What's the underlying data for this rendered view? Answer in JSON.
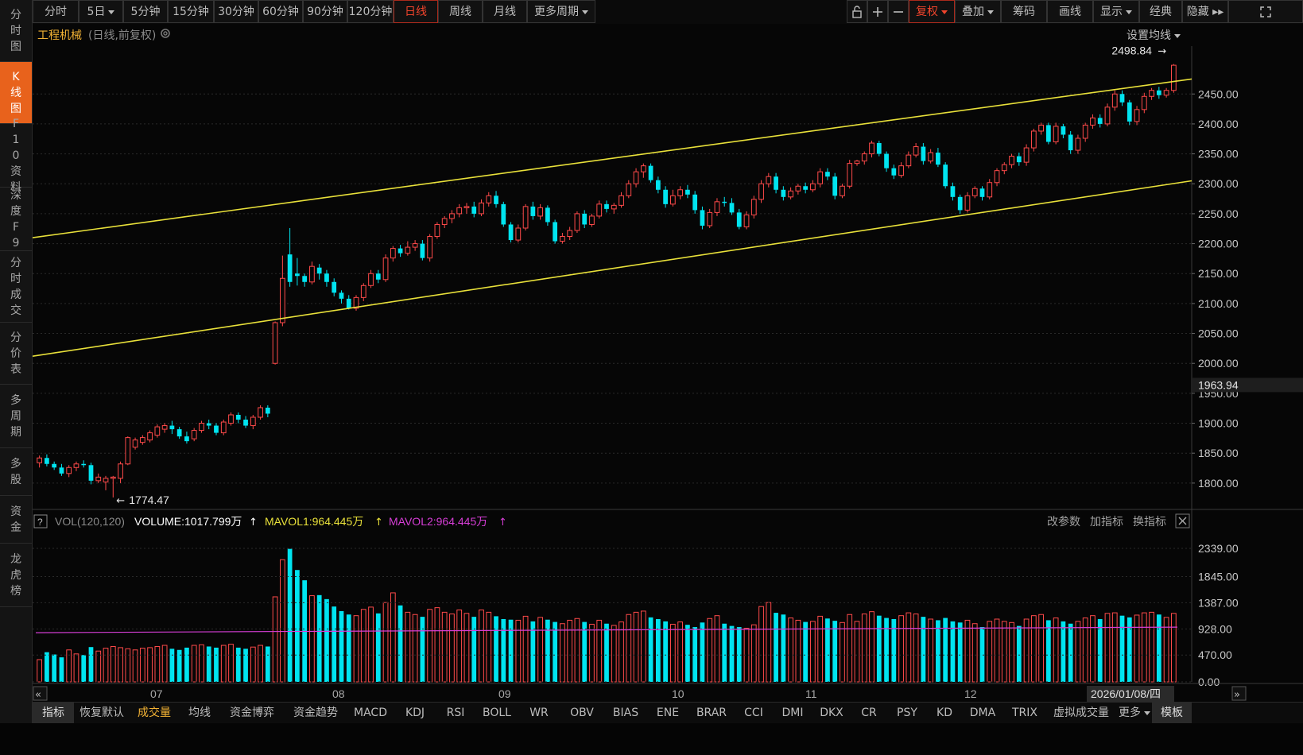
{
  "left_nav": [
    {
      "label": "分时图",
      "active": false
    },
    {
      "label": "K线图",
      "active": true
    },
    {
      "label": "F10资料",
      "active": false
    },
    {
      "label": "深度F9",
      "active": false
    },
    {
      "label": "分时成交",
      "active": false
    },
    {
      "label": "分价表",
      "active": false
    },
    {
      "label": "多周期",
      "active": false
    },
    {
      "label": "多股",
      "active": false
    },
    {
      "label": "资金",
      "active": false
    },
    {
      "label": "龙虎榜",
      "active": false
    }
  ],
  "period_tabs": [
    {
      "label": "分时"
    },
    {
      "label": "5日",
      "caret": true
    },
    {
      "label": "5分钟"
    },
    {
      "label": "15分钟"
    },
    {
      "label": "30分钟"
    },
    {
      "label": "60分钟"
    },
    {
      "label": "90分钟"
    },
    {
      "label": "120分钟"
    },
    {
      "label": "日线",
      "active": true
    },
    {
      "label": "周线"
    },
    {
      "label": "月线"
    },
    {
      "label": "更多周期",
      "caret": true
    }
  ],
  "right_tools": [
    {
      "label": "复权",
      "caret": true,
      "active": true
    },
    {
      "label": "叠加",
      "caret": true
    },
    {
      "label": "筹码"
    },
    {
      "label": "画线"
    },
    {
      "label": "显示",
      "caret": true
    },
    {
      "label": "经典"
    },
    {
      "label": "隐藏 ▸▸"
    }
  ],
  "chart_header": {
    "name": "工程机械",
    "mode": "(日线,前复权)",
    "ma_setting": "设置均线"
  },
  "indicator_header": {
    "help": "?",
    "name": "VOL(120,120)",
    "volume": "VOLUME:1017.799万",
    "mavol1": "MAVOL1:964.445万",
    "mavol2": "MAVOL2:964.445万",
    "change_params": "改参数",
    "add_indicator": "加指标",
    "switch_indicator": "换指标"
  },
  "colors": {
    "up": "#ff4a4a",
    "down": "#00e4f0",
    "channel": "#e8e03a",
    "mavol1": "#e8e03a",
    "mavol2": "#d63ed6",
    "accent": "#e8621c"
  },
  "chart_data": {
    "type": "candlestick",
    "price_axis": [
      "2450.00",
      "2400.00",
      "2350.00",
      "2300.00",
      "2250.00",
      "2200.00",
      "2150.00",
      "2100.00",
      "2050.00",
      "2000.00",
      "1950.00",
      "1900.00",
      "1850.00",
      "1800.00"
    ],
    "price_range": [
      1760,
      2530
    ],
    "current_price": "1963.94",
    "high_label": "2498.84",
    "low_label": "1774.47",
    "volume_axis": [
      "2339.00",
      "1845.00",
      "1387.00",
      "928.00",
      "470.00",
      "0.00"
    ],
    "volume_max": 2339,
    "month_labels": [
      "07",
      "08",
      "09",
      "10",
      "11",
      "12"
    ],
    "cursor_date": "2026/01/08/四",
    "channel_lines": [
      {
        "from": [
          0,
          2210
        ],
        "to": [
          1,
          2475
        ]
      },
      {
        "from": [
          0,
          2012
        ],
        "to": [
          1,
          2305
        ]
      }
    ],
    "mavol_level": 820,
    "candles": [
      [
        1834,
        1842,
        1826,
        1846,
        390
      ],
      [
        1842,
        1832,
        1828,
        1848,
        520
      ],
      [
        1832,
        1826,
        1822,
        1836,
        480
      ],
      [
        1826,
        1816,
        1812,
        1832,
        430
      ],
      [
        1816,
        1826,
        1810,
        1830,
        560
      ],
      [
        1826,
        1832,
        1820,
        1836,
        490
      ],
      [
        1832,
        1830,
        1826,
        1838,
        470
      ],
      [
        1830,
        1804,
        1798,
        1834,
        610
      ],
      [
        1804,
        1810,
        1800,
        1816,
        540
      ],
      [
        1802,
        1808,
        1788,
        1812,
        590
      ],
      [
        1808,
        1810,
        1776,
        1812,
        620
      ],
      [
        1808,
        1832,
        1800,
        1836,
        600
      ],
      [
        1832,
        1876,
        1830,
        1878,
        580
      ],
      [
        1860,
        1872,
        1856,
        1876,
        560
      ],
      [
        1868,
        1876,
        1864,
        1880,
        590
      ],
      [
        1872,
        1884,
        1868,
        1888,
        600
      ],
      [
        1880,
        1894,
        1876,
        1898,
        620
      ],
      [
        1890,
        1896,
        1884,
        1900,
        640
      ],
      [
        1896,
        1890,
        1882,
        1904,
        580
      ],
      [
        1890,
        1878,
        1874,
        1894,
        560
      ],
      [
        1878,
        1870,
        1866,
        1886,
        600
      ],
      [
        1874,
        1888,
        1870,
        1892,
        640
      ],
      [
        1888,
        1900,
        1884,
        1904,
        650
      ],
      [
        1900,
        1896,
        1890,
        1906,
        620
      ],
      [
        1896,
        1884,
        1880,
        1900,
        600
      ],
      [
        1884,
        1902,
        1880,
        1906,
        640
      ],
      [
        1900,
        1914,
        1896,
        1918,
        660
      ],
      [
        1914,
        1906,
        1900,
        1918,
        600
      ],
      [
        1906,
        1896,
        1892,
        1912,
        580
      ],
      [
        1896,
        1910,
        1890,
        1914,
        610
      ],
      [
        1910,
        1926,
        1906,
        1930,
        640
      ],
      [
        1926,
        1916,
        1910,
        1930,
        620
      ],
      [
        2000,
        2068,
        1998,
        2070,
        1490
      ],
      [
        2068,
        2142,
        2062,
        2180,
        2140
      ],
      [
        2182,
        2136,
        2128,
        2226,
        2330
      ],
      [
        2150,
        2146,
        2130,
        2176,
        1960
      ],
      [
        2146,
        2136,
        2128,
        2150,
        1780
      ],
      [
        2136,
        2162,
        2132,
        2170,
        1510
      ],
      [
        2160,
        2150,
        2140,
        2166,
        1520
      ],
      [
        2150,
        2136,
        2128,
        2156,
        1450
      ],
      [
        2136,
        2118,
        2112,
        2142,
        1320
      ],
      [
        2118,
        2108,
        2100,
        2122,
        1240
      ],
      [
        2108,
        2092,
        2090,
        2114,
        1180
      ],
      [
        2092,
        2110,
        2088,
        2114,
        1160
      ],
      [
        2110,
        2130,
        2104,
        2134,
        1270
      ],
      [
        2130,
        2150,
        2126,
        2156,
        1310
      ],
      [
        2150,
        2140,
        2134,
        2156,
        1200
      ],
      [
        2140,
        2176,
        2136,
        2182,
        1390
      ],
      [
        2176,
        2192,
        2170,
        2196,
        1560
      ],
      [
        2192,
        2184,
        2178,
        2198,
        1340
      ],
      [
        2184,
        2194,
        2180,
        2204,
        1220
      ],
      [
        2194,
        2200,
        2188,
        2206,
        1180
      ],
      [
        2200,
        2176,
        2172,
        2206,
        1140
      ],
      [
        2176,
        2212,
        2170,
        2216,
        1270
      ],
      [
        2212,
        2232,
        2208,
        2236,
        1300
      ],
      [
        2232,
        2242,
        2226,
        2246,
        1220
      ],
      [
        2242,
        2250,
        2234,
        2256,
        1190
      ],
      [
        2250,
        2260,
        2244,
        2266,
        1260
      ],
      [
        2260,
        2262,
        2250,
        2268,
        1200
      ],
      [
        2262,
        2250,
        2244,
        2270,
        1140
      ],
      [
        2250,
        2268,
        2246,
        2274,
        1260
      ],
      [
        2268,
        2280,
        2262,
        2286,
        1220
      ],
      [
        2280,
        2266,
        2260,
        2288,
        1150
      ],
      [
        2266,
        2232,
        2228,
        2270,
        1100
      ],
      [
        2232,
        2206,
        2202,
        2236,
        1090
      ],
      [
        2206,
        2226,
        2202,
        2232,
        1080
      ],
      [
        2226,
        2262,
        2222,
        2266,
        1150
      ],
      [
        2262,
        2246,
        2240,
        2270,
        1060
      ],
      [
        2246,
        2260,
        2240,
        2266,
        1130
      ],
      [
        2260,
        2236,
        2230,
        2264,
        1090
      ],
      [
        2236,
        2204,
        2200,
        2240,
        1050
      ],
      [
        2204,
        2212,
        2200,
        2218,
        1020
      ],
      [
        2212,
        2222,
        2206,
        2228,
        1080
      ],
      [
        2222,
        2250,
        2218,
        2254,
        1110
      ],
      [
        2250,
        2232,
        2226,
        2256,
        1050
      ],
      [
        2232,
        2246,
        2228,
        2250,
        1010
      ],
      [
        2246,
        2266,
        2242,
        2272,
        1080
      ],
      [
        2266,
        2258,
        2252,
        2272,
        1020
      ],
      [
        2258,
        2264,
        2250,
        2268,
        990
      ],
      [
        2264,
        2280,
        2260,
        2286,
        1050
      ],
      [
        2280,
        2300,
        2276,
        2306,
        1180
      ],
      [
        2300,
        2320,
        2294,
        2326,
        1220
      ],
      [
        2320,
        2330,
        2310,
        2334,
        1240
      ],
      [
        2330,
        2306,
        2302,
        2334,
        1130
      ],
      [
        2306,
        2290,
        2284,
        2312,
        1100
      ],
      [
        2290,
        2266,
        2260,
        2296,
        1060
      ],
      [
        2266,
        2280,
        2262,
        2290,
        1010
      ],
      [
        2280,
        2290,
        2274,
        2296,
        1050
      ],
      [
        2290,
        2282,
        2276,
        2298,
        1000
      ],
      [
        2282,
        2256,
        2250,
        2288,
        960
      ],
      [
        2256,
        2230,
        2224,
        2262,
        1040
      ],
      [
        2230,
        2252,
        2226,
        2258,
        1110
      ],
      [
        2252,
        2270,
        2246,
        2276,
        1160
      ],
      [
        2270,
        2268,
        2262,
        2278,
        1020
      ],
      [
        2268,
        2252,
        2248,
        2276,
        980
      ],
      [
        2252,
        2228,
        2224,
        2258,
        960
      ],
      [
        2228,
        2248,
        2224,
        2254,
        940
      ],
      [
        2248,
        2274,
        2242,
        2280,
        1000
      ],
      [
        2274,
        2300,
        2268,
        2306,
        1320
      ],
      [
        2300,
        2312,
        2294,
        2318,
        1390
      ],
      [
        2312,
        2290,
        2284,
        2318,
        1210
      ],
      [
        2290,
        2278,
        2272,
        2296,
        1180
      ],
      [
        2278,
        2288,
        2274,
        2294,
        1120
      ],
      [
        2288,
        2296,
        2282,
        2300,
        1080
      ],
      [
        2296,
        2290,
        2284,
        2302,
        1050
      ],
      [
        2290,
        2300,
        2286,
        2306,
        1060
      ],
      [
        2300,
        2320,
        2294,
        2326,
        1150
      ],
      [
        2320,
        2312,
        2306,
        2326,
        1110
      ],
      [
        2312,
        2280,
        2274,
        2318,
        1070
      ],
      [
        2280,
        2296,
        2276,
        2300,
        1040
      ],
      [
        2296,
        2334,
        2292,
        2340,
        1180
      ],
      [
        2334,
        2338,
        2330,
        2340,
        1060
      ],
      [
        2338,
        2350,
        2332,
        2354,
        1190
      ],
      [
        2350,
        2368,
        2344,
        2372,
        1230
      ],
      [
        2368,
        2350,
        2346,
        2372,
        1160
      ],
      [
        2350,
        2326,
        2320,
        2354,
        1120
      ],
      [
        2326,
        2314,
        2308,
        2332,
        1100
      ],
      [
        2314,
        2330,
        2310,
        2336,
        1160
      ],
      [
        2330,
        2348,
        2326,
        2354,
        1210
      ],
      [
        2348,
        2362,
        2344,
        2368,
        1190
      ],
      [
        2362,
        2338,
        2332,
        2368,
        1140
      ],
      [
        2338,
        2352,
        2334,
        2358,
        1100
      ],
      [
        2352,
        2332,
        2328,
        2360,
        1080
      ],
      [
        2332,
        2296,
        2292,
        2336,
        1120
      ],
      [
        2296,
        2278,
        2272,
        2302,
        1060
      ],
      [
        2278,
        2256,
        2250,
        2282,
        1040
      ],
      [
        2256,
        2280,
        2252,
        2286,
        1080
      ],
      [
        2280,
        2292,
        2276,
        2296,
        1020
      ],
      [
        2292,
        2278,
        2272,
        2296,
        960
      ],
      [
        2278,
        2302,
        2274,
        2308,
        1060
      ],
      [
        2302,
        2322,
        2296,
        2326,
        1100
      ],
      [
        2322,
        2332,
        2316,
        2336,
        1060
      ],
      [
        2332,
        2346,
        2326,
        2350,
        1040
      ],
      [
        2346,
        2336,
        2330,
        2352,
        980
      ],
      [
        2336,
        2360,
        2330,
        2366,
        1100
      ],
      [
        2360,
        2388,
        2354,
        2392,
        1160
      ],
      [
        2388,
        2398,
        2382,
        2402,
        1180
      ],
      [
        2398,
        2370,
        2366,
        2402,
        1080
      ],
      [
        2370,
        2396,
        2366,
        2402,
        1120
      ],
      [
        2396,
        2382,
        2376,
        2400,
        1060
      ],
      [
        2382,
        2356,
        2350,
        2388,
        1020
      ],
      [
        2356,
        2376,
        2350,
        2382,
        1060
      ],
      [
        2376,
        2398,
        2370,
        2402,
        1120
      ],
      [
        2398,
        2410,
        2392,
        2416,
        1160
      ],
      [
        2410,
        2400,
        2394,
        2416,
        1100
      ],
      [
        2400,
        2428,
        2396,
        2434,
        1200
      ],
      [
        2428,
        2450,
        2422,
        2456,
        1210
      ],
      [
        2450,
        2436,
        2430,
        2456,
        1160
      ],
      [
        2436,
        2404,
        2398,
        2440,
        1130
      ],
      [
        2404,
        2424,
        2398,
        2430,
        1170
      ],
      [
        2424,
        2446,
        2418,
        2452,
        1210
      ],
      [
        2446,
        2456,
        2440,
        2460,
        1220
      ],
      [
        2456,
        2448,
        2442,
        2462,
        1180
      ],
      [
        2448,
        2456,
        2444,
        2460,
        1130
      ],
      [
        2456,
        2498,
        2452,
        2500,
        1200
      ]
    ]
  },
  "bottom_tabs": [
    {
      "label": "指标",
      "boxed": true
    },
    {
      "label": "恢复默认"
    },
    {
      "label": "成交量",
      "active": true
    },
    {
      "label": "均线"
    },
    {
      "label": "资金博弈"
    },
    {
      "label": "资金趋势"
    },
    {
      "label": "MACD"
    },
    {
      "label": "KDJ"
    },
    {
      "label": "RSI"
    },
    {
      "label": "BOLL"
    },
    {
      "label": "WR"
    },
    {
      "label": "OBV"
    },
    {
      "label": "BIAS"
    },
    {
      "label": "ENE"
    },
    {
      "label": "BRAR"
    },
    {
      "label": "CCI"
    },
    {
      "label": "DMI"
    },
    {
      "label": "DKX"
    },
    {
      "label": "CR"
    },
    {
      "label": "PSY"
    },
    {
      "label": "KD"
    },
    {
      "label": "DMA"
    },
    {
      "label": "TRIX"
    },
    {
      "label": "虚拟成交量"
    },
    {
      "label": "更多",
      "caret": true
    },
    {
      "label": "模板",
      "boxed": true
    }
  ]
}
